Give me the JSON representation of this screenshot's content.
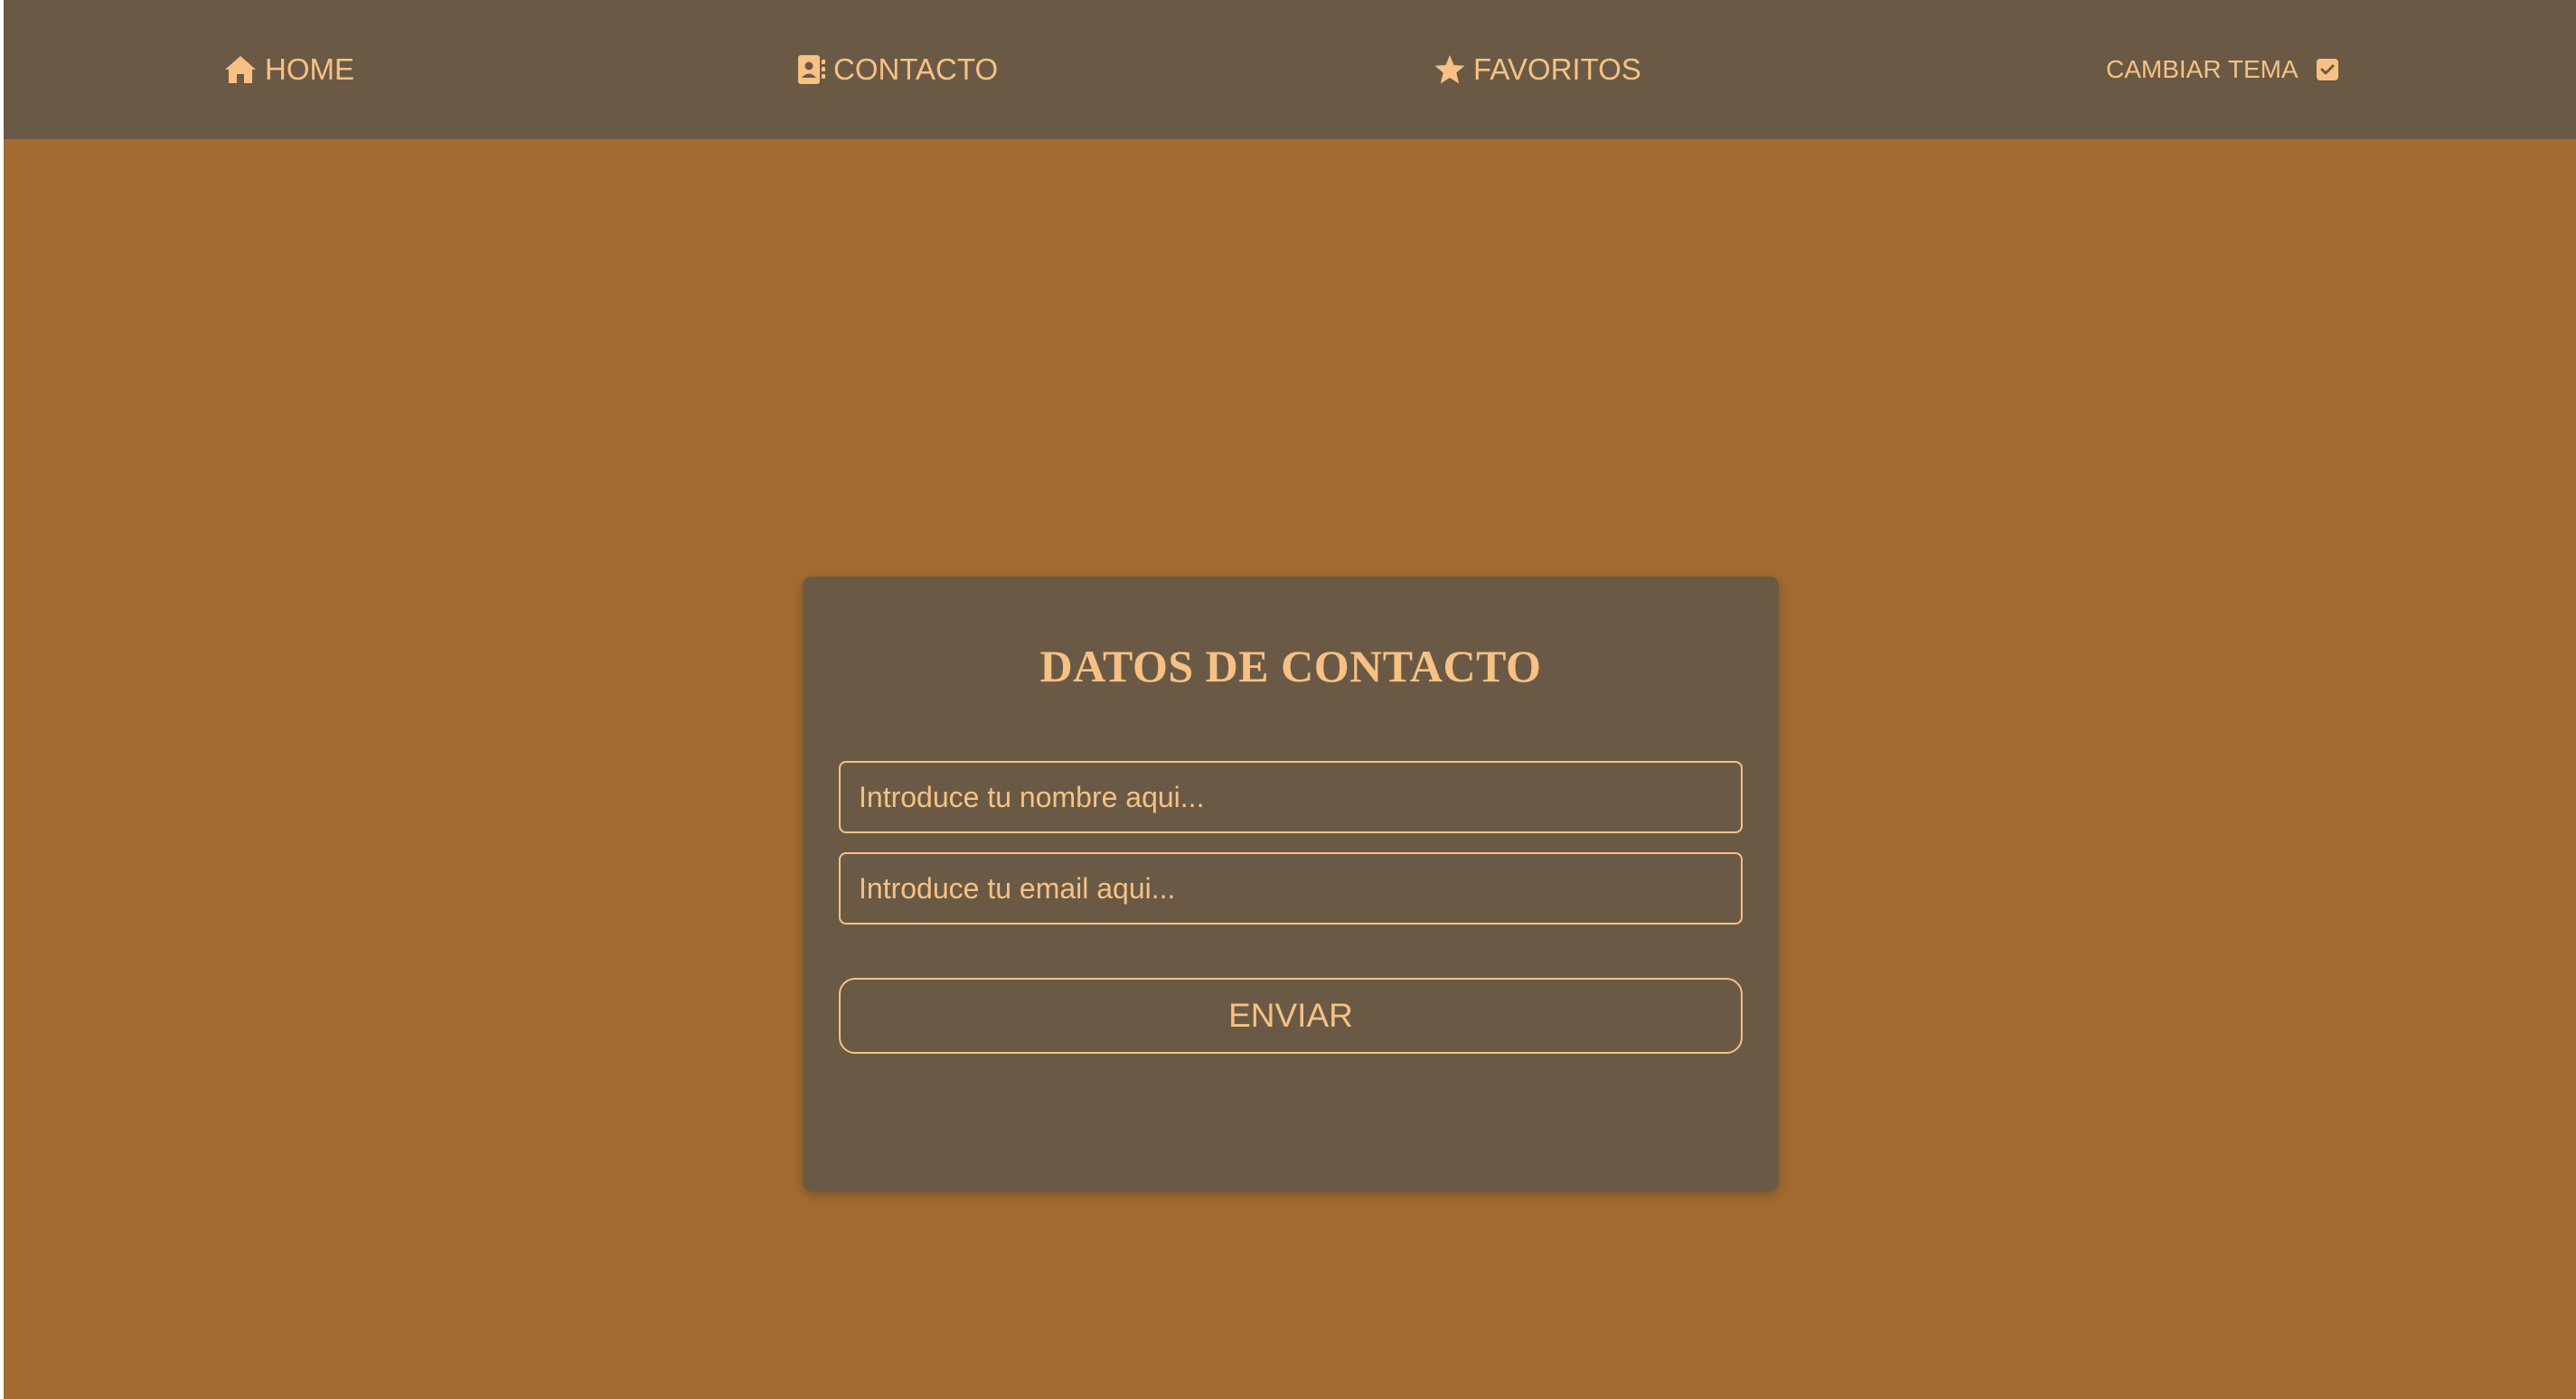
{
  "nav": {
    "home": {
      "label": "HOME",
      "icon": "home-icon"
    },
    "contact": {
      "label": "CONTACTO",
      "icon": "contact-book-icon"
    },
    "favorites": {
      "label": "FAVORITOS",
      "icon": "star-icon"
    },
    "theme": {
      "label": "CAMBIAR TEMA",
      "checked": true
    }
  },
  "form": {
    "title": "DATOS DE CONTACTO",
    "name_placeholder": "Introduce tu nombre aqui...",
    "email_placeholder": "Introduce tu email aqui...",
    "submit_label": "ENVIAR"
  },
  "colors": {
    "background": "#a36b32",
    "surface": "#6a5a45",
    "accent": "#f7c184"
  }
}
